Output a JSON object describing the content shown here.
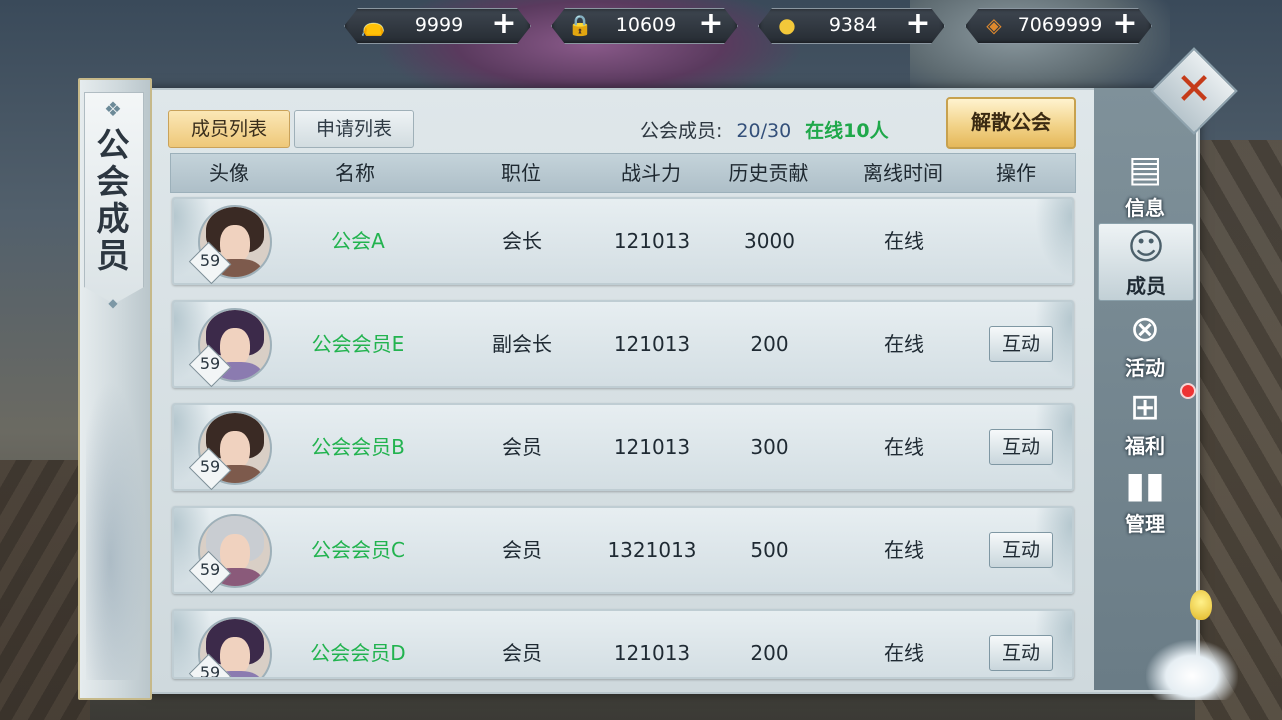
{
  "currency": [
    {
      "icon": "currency-bag-icon",
      "value": "9999"
    },
    {
      "icon": "locked-gold-ingot-icon",
      "value": "10609"
    },
    {
      "icon": "gold-ingot-icon",
      "value": "9384"
    },
    {
      "icon": "copper-coin-icon",
      "value": "7069999"
    }
  ],
  "banner": {
    "title": "公会成员"
  },
  "tabs": [
    {
      "label": "成员列表",
      "active": true
    },
    {
      "label": "申请列表",
      "active": false
    }
  ],
  "summary": {
    "label": "公会成员:",
    "count": "20/30",
    "online": "在线10人"
  },
  "disband_label": "解散公会",
  "columns": [
    "头像",
    "名称",
    "职位",
    "战斗力",
    "历史贡献",
    "离线时间",
    "操作"
  ],
  "members": [
    {
      "level": "59",
      "name": "公会A",
      "role": "会长",
      "power": "121013",
      "contribution": "3000",
      "status": "在线",
      "action": ""
    },
    {
      "level": "59",
      "name": "公会会员E",
      "role": "副会长",
      "power": "121013",
      "contribution": "200",
      "status": "在线",
      "action": "互动"
    },
    {
      "level": "59",
      "name": "公会会员B",
      "role": "会员",
      "power": "121013",
      "contribution": "300",
      "status": "在线",
      "action": "互动"
    },
    {
      "level": "59",
      "name": "公会会员C",
      "role": "会员",
      "power": "1321013",
      "contribution": "500",
      "status": "在线",
      "action": "互动"
    },
    {
      "level": "59",
      "name": "公会会员D",
      "role": "会员",
      "power": "121013",
      "contribution": "200",
      "status": "在线",
      "action": "互动"
    }
  ],
  "side_nav": [
    {
      "label": "信息",
      "icon": "info-scroll-icon",
      "active": false
    },
    {
      "label": "成员",
      "icon": "member-icon",
      "active": true
    },
    {
      "label": "活动",
      "icon": "activity-icon",
      "active": false
    },
    {
      "label": "福利",
      "icon": "gift-icon",
      "active": false
    },
    {
      "label": "管理",
      "icon": "manage-cards-icon",
      "active": false
    }
  ],
  "colors": {
    "online_green": "#22b34f",
    "tab_active": "#eec879",
    "close_x": "#c53b19"
  }
}
